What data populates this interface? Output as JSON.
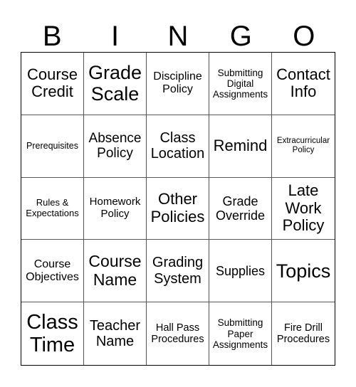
{
  "header": [
    "B",
    "I",
    "N",
    "G",
    "O"
  ],
  "cells": [
    [
      "Course Credit",
      "Grade Scale",
      "Discipline Policy",
      "Submitting Digital Assignments",
      "Contact Info"
    ],
    [
      "Prerequisites",
      "Absence Policy",
      "Class Location",
      "Remind",
      "Extracurricular Policy"
    ],
    [
      "Rules & Expectations",
      "Homework Policy",
      "Other Policies",
      "Grade Override",
      "Late Work Policy"
    ],
    [
      "Course Objectives",
      "Course Name",
      "Grading System",
      "Supplies",
      "Topics"
    ],
    [
      "Class Time",
      "Teacher Name",
      "Hall Pass Procedures",
      "Submitting Paper Assignments",
      "Fire Drill Procedures"
    ]
  ]
}
